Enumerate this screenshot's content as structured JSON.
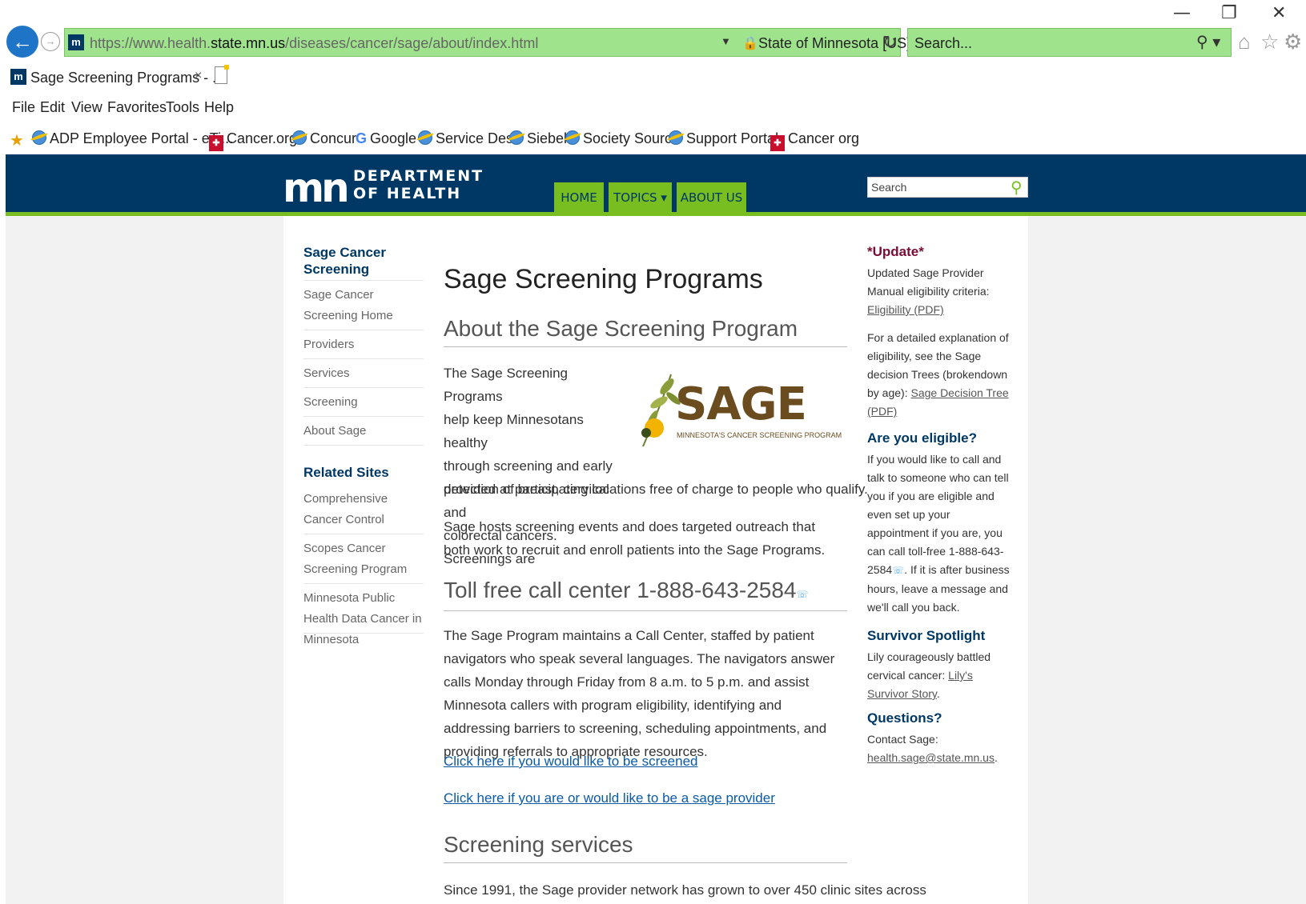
{
  "window": {
    "minimize": "—",
    "restore": "❐",
    "close": "✕"
  },
  "browser": {
    "back_icon": "back-arrow-icon",
    "url_prefix": "https://www.health.",
    "url_domain": "state.mn.us",
    "url_path": "/diseases/cancer/sage/about/index.html",
    "cert_label": "State of Minnesota [US]",
    "search_placeholder": "Search...",
    "tab_title": "Sage Screening Programs - ...",
    "tab_close": "×",
    "favicon": "m"
  },
  "menu": [
    "File",
    "Edit",
    "View",
    "Favorites",
    "Tools",
    "Help"
  ],
  "favorites": [
    {
      "label": "ADP Employee Portal - eTi...",
      "icon": "ie"
    },
    {
      "label": "Cancer.org",
      "icon": "acs"
    },
    {
      "label": "Concur",
      "icon": "ie"
    },
    {
      "label": "Google",
      "icon": "google"
    },
    {
      "label": "Service Desk",
      "icon": "ie"
    },
    {
      "label": "Siebel",
      "icon": "ie"
    },
    {
      "label": "Society Source",
      "icon": "ie"
    },
    {
      "label": "Support Portal",
      "icon": "ie"
    },
    {
      "label": "Cancer org",
      "icon": "acs"
    }
  ],
  "site": {
    "logo_mark": "mn",
    "logo_line1": "DEPARTMENT",
    "logo_line2": "OF HEALTH",
    "nav": [
      "HOME",
      "TOPICS ▾",
      "ABOUT US"
    ],
    "search_placeholder": "Search",
    "colors": {
      "header": "#003865",
      "accent": "#78be20"
    }
  },
  "left_nav": {
    "heading1": "Sage Cancer Screening",
    "items1": [
      "Sage Cancer Screening Home",
      "Providers",
      "Services",
      "Screening",
      "About Sage"
    ],
    "heading2": "Related Sites",
    "items2": [
      "Comprehensive Cancer Control",
      "Scopes Cancer Screening Program",
      "Minnesota Public Health Data Cancer in Minnesota"
    ]
  },
  "main": {
    "title": "Sage Screening Programs",
    "about_heading": "About the Sage Screening Program",
    "intro_lines": [
      "The Sage Screening Programs",
      "help keep Minnesotans healthy",
      "through screening and early",
      "detection of breast, cervical and",
      "colorectal cancers. Screenings are"
    ],
    "intro_tail": "provided at participating locations free of charge to people who qualify.",
    "para2": "Sage hosts screening events and does targeted outreach that both work to recruit and enroll patients into the Sage Programs.",
    "call_heading": "Toll free call center 1-888-643-2584",
    "call_para": "The Sage Program maintains a Call Center, staffed by patient navigators who speak several languages. The navigators answer calls Monday through Friday from 8 a.m. to 5 p.m. and assist Minnesota callers with program eligibility, identifying and addressing barriers to screening, scheduling appointments, and providing referrals to appropriate resources.",
    "link1": "Click here if you would like to be screened",
    "link2": "Click here if you are or would like to be a sage provider",
    "services_heading": "Screening services",
    "services_para": "Since 1991, the Sage provider network has grown to over 450 clinic sites across",
    "sage_logo_word": "SAGE",
    "sage_logo_tag": "MINNESOTA'S CANCER SCREENING PROGRAM"
  },
  "right": {
    "update_heading": "*Update*",
    "update_text": "Updated Sage Provider Manual eligibility criteria:",
    "update_link": "Eligibility (PDF)",
    "detail_text": "For a detailed explanation of eligibility, see the Sage decision Trees (brokendown by age):",
    "detail_link": "Sage Decision Tree (PDF)",
    "eligible_heading": "Are you eligible?",
    "eligible_text_a": "If you would like to call and talk to someone who can tell you if you are eligible and even set up your appointment if you are, you can call toll-free 1-888-643-2584",
    "eligible_text_b": ". If it is after business hours, leave a message and we'll call you back.",
    "survivor_heading": "Survivor Spotlight",
    "survivor_text": "Lily courageously battled cervical cancer:",
    "survivor_link": "Lily's Survivor Story",
    "questions_heading": "Questions?",
    "questions_text": "Contact Sage:",
    "questions_link": "health.sage@state.mn.us"
  }
}
